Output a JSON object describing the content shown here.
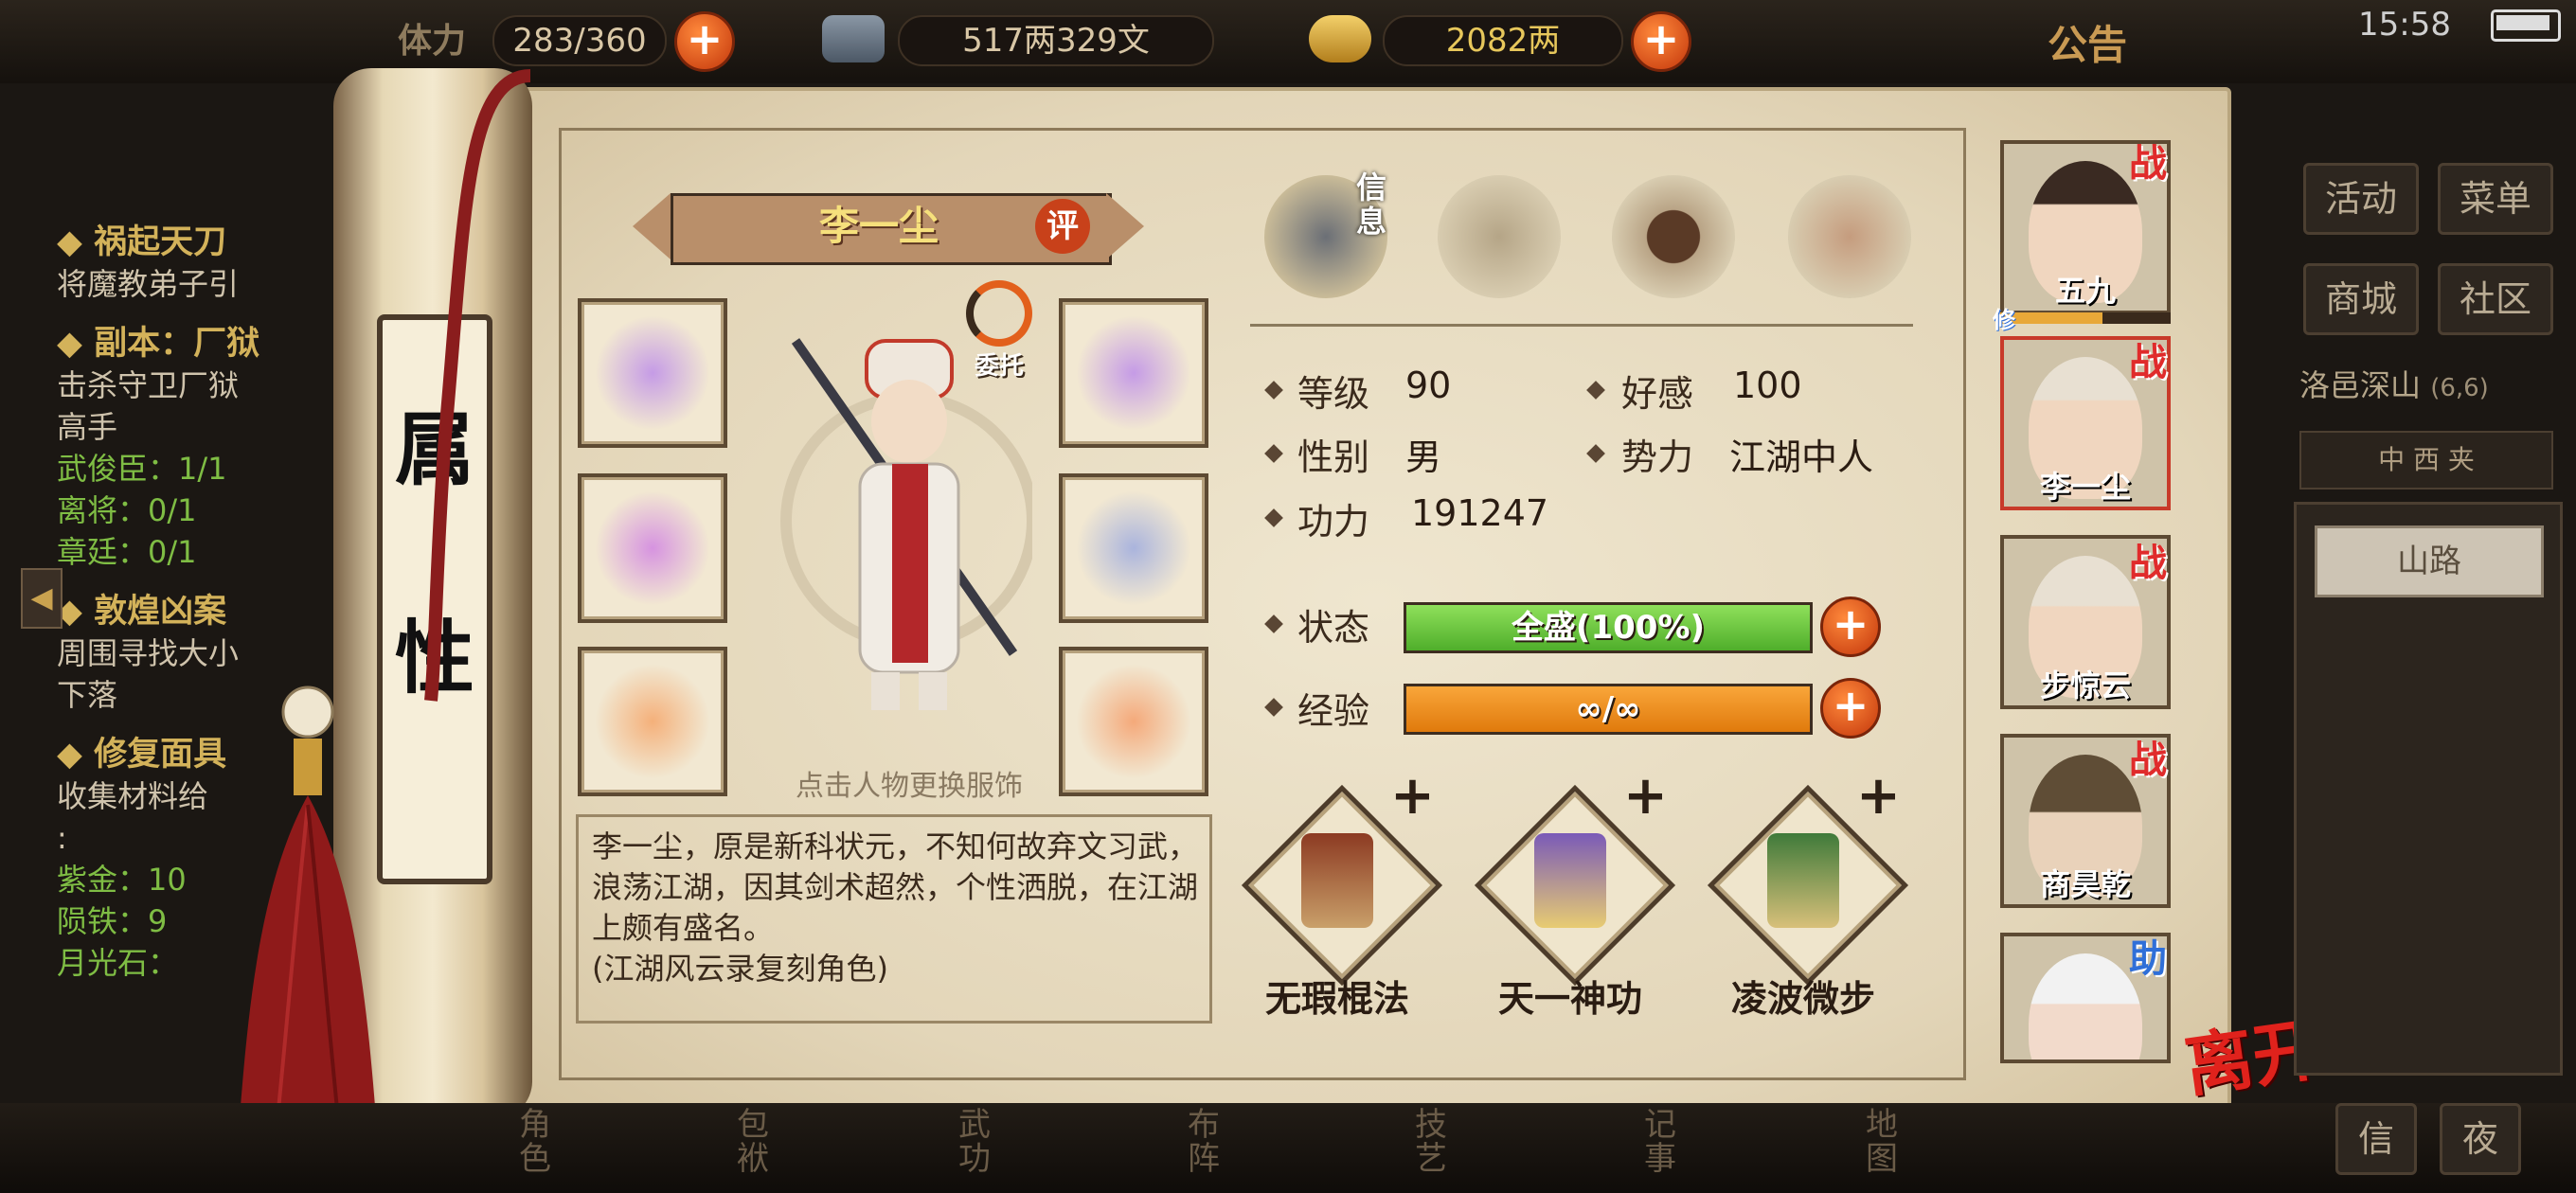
{
  "topbar": {
    "stamina_label": "体力",
    "stamina_value": "283/360",
    "money_value": "517两329文",
    "gold_value": "2082两",
    "announcement": "公告",
    "time": "15:58"
  },
  "quests": [
    {
      "title": "祸起天刀",
      "lines": [
        "将魔教弟子引"
      ]
    },
    {
      "title": "副本：厂狱",
      "lines": [
        "击杀守卫厂狱",
        "高手"
      ],
      "green": [
        "武俊臣：1/1",
        "离将：0/1",
        "章廷：0/1"
      ]
    },
    {
      "title": "敦煌凶案",
      "lines": [
        "周围寻找大小",
        "下落"
      ]
    },
    {
      "title": "修复面具",
      "lines": [
        "收集材料给",
        ":"
      ],
      "green": [
        "紫金：10",
        "陨铁：9",
        "月光石："
      ]
    }
  ],
  "roller": {
    "char1": "属",
    "char2": "性"
  },
  "character": {
    "name": "李一尘",
    "eval_badge": "评",
    "delegate_label": "委托",
    "outfit_hint": "点击人物更换服饰",
    "description": "李一尘，原是新科状元，不知何故弃文习武，浪荡江湖，因其剑术超然，个性洒脱，在江湖上颇有盛名。",
    "description_note": "(江湖风云录复刻角色)"
  },
  "tabs": {
    "info_label": "信息"
  },
  "stats": {
    "level_label": "等级",
    "level_value": "90",
    "favor_label": "好感",
    "favor_value": "100",
    "gender_label": "性别",
    "gender_value": "男",
    "faction_label": "势力",
    "faction_value": "江湖中人",
    "power_label": "功力",
    "power_value": "191247",
    "status_label": "状态",
    "status_text": "全盛(100%)",
    "status_fill": 1.0,
    "exp_label": "经验",
    "exp_text": "∞/∞",
    "exp_fill": 1.0
  },
  "skills": [
    {
      "name": "无瑕棍法"
    },
    {
      "name": "天一神功"
    },
    {
      "name": "凌波微步"
    }
  ],
  "roster": [
    {
      "name": "五九",
      "tag": "战",
      "sub": "修"
    },
    {
      "name": "李一尘",
      "tag": "战"
    },
    {
      "name": "步惊云",
      "tag": "战"
    },
    {
      "name": "商昊乾",
      "tag": "战"
    },
    {
      "name": "",
      "tag": "助"
    }
  ],
  "leave_label": "离开",
  "right_menu": {
    "activity": "活动",
    "menu": "菜单",
    "shop": "商城",
    "community": "社区",
    "location": "洛邑深山",
    "coords": "(6,6)",
    "compass": "中 西 夹",
    "road": "山路",
    "btn1": "信",
    "btn2": "夜"
  },
  "bottom_menu": [
    "角色",
    "包袱",
    "武功",
    "布阵",
    "技艺",
    "记事",
    "地图"
  ],
  "colors": {
    "status_fill": "#5fc437",
    "exp_fill": "#f08a14",
    "tag_red": "#e02b2b",
    "tag_blue": "#2f6fd8",
    "gold_text": "#f6e07c"
  }
}
